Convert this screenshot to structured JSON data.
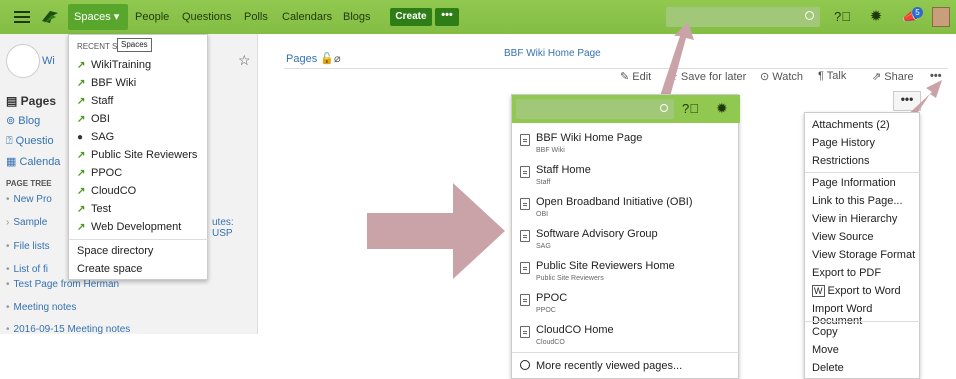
{
  "topbar": {
    "nav": [
      "Spaces",
      "People",
      "Questions",
      "Polls",
      "Calendars",
      "Blogs"
    ],
    "create": "Create",
    "more": "•••",
    "notif_count": "5"
  },
  "sidebar": {
    "space_title": "Wi",
    "links": [
      "Pages",
      "Blog",
      "Questio",
      "Calenda"
    ],
    "page_tree_label": "PAGE TREE",
    "tree": [
      "New Pro",
      "Sample",
      "File lists",
      "List of fi",
      "Test Page from Herman",
      "Meeting notes",
      "2016-09-15 Meeting notes"
    ],
    "tree_extra": "utes: USP"
  },
  "spaces_menu": {
    "label": "RECENT S",
    "tooltip": "Spaces",
    "items": [
      "WikiTraining",
      "BBF Wiki",
      "Staff",
      "OBI",
      "SAG",
      "Public Site Reviewers",
      "PPOC",
      "CloudCO",
      "Test",
      "Web Development"
    ],
    "directory": "Space directory",
    "create": "Create space"
  },
  "page": {
    "title": "BBF Wiki Home Page",
    "pages": "Pages",
    "edit": "Edit",
    "save_later": "Save for later",
    "watch": "Watch",
    "talk": "Talk",
    "share": "Share",
    "more": "•••"
  },
  "recent": {
    "items": [
      {
        "title": "BBF Wiki Home Page",
        "space": "BBF Wiki"
      },
      {
        "title": "Staff Home",
        "space": "Staff"
      },
      {
        "title": "Open Broadband Initiative (OBI)",
        "space": "OBI"
      },
      {
        "title": "Software Advisory Group",
        "space": "SAG"
      },
      {
        "title": "Public Site Reviewers Home",
        "space": "Public Site Reviewers"
      },
      {
        "title": "PPOC",
        "space": "PPOC"
      },
      {
        "title": "CloudCO Home",
        "space": "CloudCO"
      }
    ],
    "footer": "More recently viewed pages..."
  },
  "more_menu": {
    "group1": [
      "Attachments (2)",
      "Page History",
      "Restrictions"
    ],
    "group2": [
      "Page Information",
      "Link to this Page...",
      "View in Hierarchy",
      "View Source",
      "View Storage Format",
      "Export to PDF",
      "Export to Word",
      "Import Word Document"
    ],
    "group3": [
      "Copy",
      "Move",
      "Delete"
    ]
  }
}
